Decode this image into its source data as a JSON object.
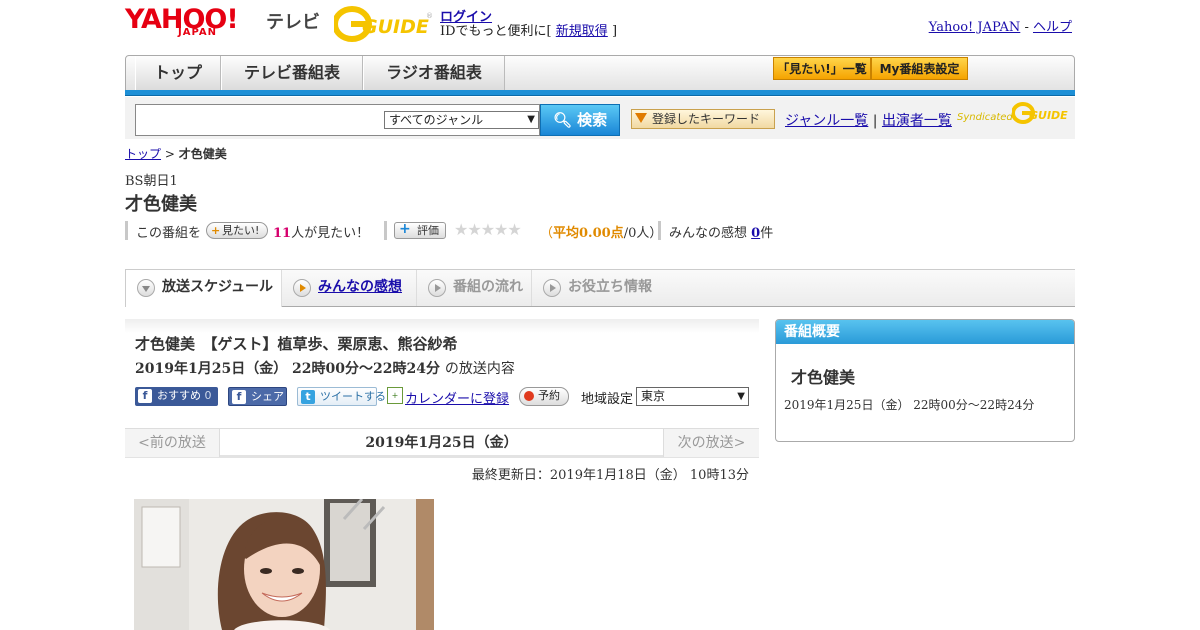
{
  "header": {
    "logo_yahoo": "YAHOO!",
    "logo_japan": "JAPAN",
    "logo_tv": "テレビ",
    "gguide_logo": "GUIDE",
    "login_label": "ログイン",
    "login_note_prefix": "IDでもっと便利に[",
    "register_label": "新規取得",
    "login_note_suffix": "]",
    "yahoo_japan_link": "Yahoo! JAPAN",
    "separator": "-",
    "help_link": "ヘルプ"
  },
  "nav": {
    "tabs": [
      "トップ",
      "テレビ番組表",
      "ラジオ番組表"
    ],
    "want_list_button": "「見たい!」一覧",
    "my_schedule_button": "My番組表設定"
  },
  "search": {
    "genre_selected": "すべてのジャンル",
    "search_button": "検索",
    "keyword_button": "登録したキーワード",
    "genre_list_link": "ジャンル一覧",
    "link_separator": "|",
    "performer_list_link": "出演者一覧",
    "syndicated": "Syndicated"
  },
  "breadcrumb": {
    "home": "トップ",
    "separator": ">",
    "current": "才色健美"
  },
  "program": {
    "channel": "BS朝日1",
    "title": "才色健美",
    "want_prefix": "この番組を",
    "want_button": "見たい!",
    "want_count": "11",
    "want_suffix": "人が見たい！",
    "rate_button": "評価",
    "stars": "★★★★★",
    "avg_open": "（",
    "avg_label": "平均0.00点",
    "avg_count": "/0人）",
    "impressions_label": "みんなの感想",
    "impressions_count": "0",
    "impressions_suffix": "件"
  },
  "content_tabs": [
    "放送スケジュール",
    "みんなの感想",
    "番組の流れ",
    "お役立ち情報"
  ],
  "episode": {
    "title": "才色健美　【ゲスト】植草歩、栗原恵、熊谷紗希",
    "date": "2019年1月25日（金）  22時00分～22時24分",
    "date_suffix": "の放送内容",
    "recommend_label": "おすすめ",
    "recommend_count": "0",
    "share_label": "シェア",
    "tweet_label": "ツイートする",
    "calendar_label": "カレンダーに登録",
    "reserve_label": "予約",
    "region_label": "地域設定",
    "region_value": "東京"
  },
  "broadcast_nav": {
    "prev": "<前の放送",
    "date": "2019年1月25日（金）",
    "next": "次の放送>"
  },
  "last_updated": "最終更新日：2019年1月18日（金） 10時13分",
  "sidebar": {
    "heading": "番組概要",
    "title": "才色健美",
    "date": "2019年1月25日（金） 22時00分～22時24分"
  },
  "colors": {
    "accent_blue": "#1d8fd6",
    "yahoo_red": "#e60012",
    "gguide_yellow": "#f5c400",
    "orange": "#f5a300",
    "pink_count": "#d6006d"
  }
}
